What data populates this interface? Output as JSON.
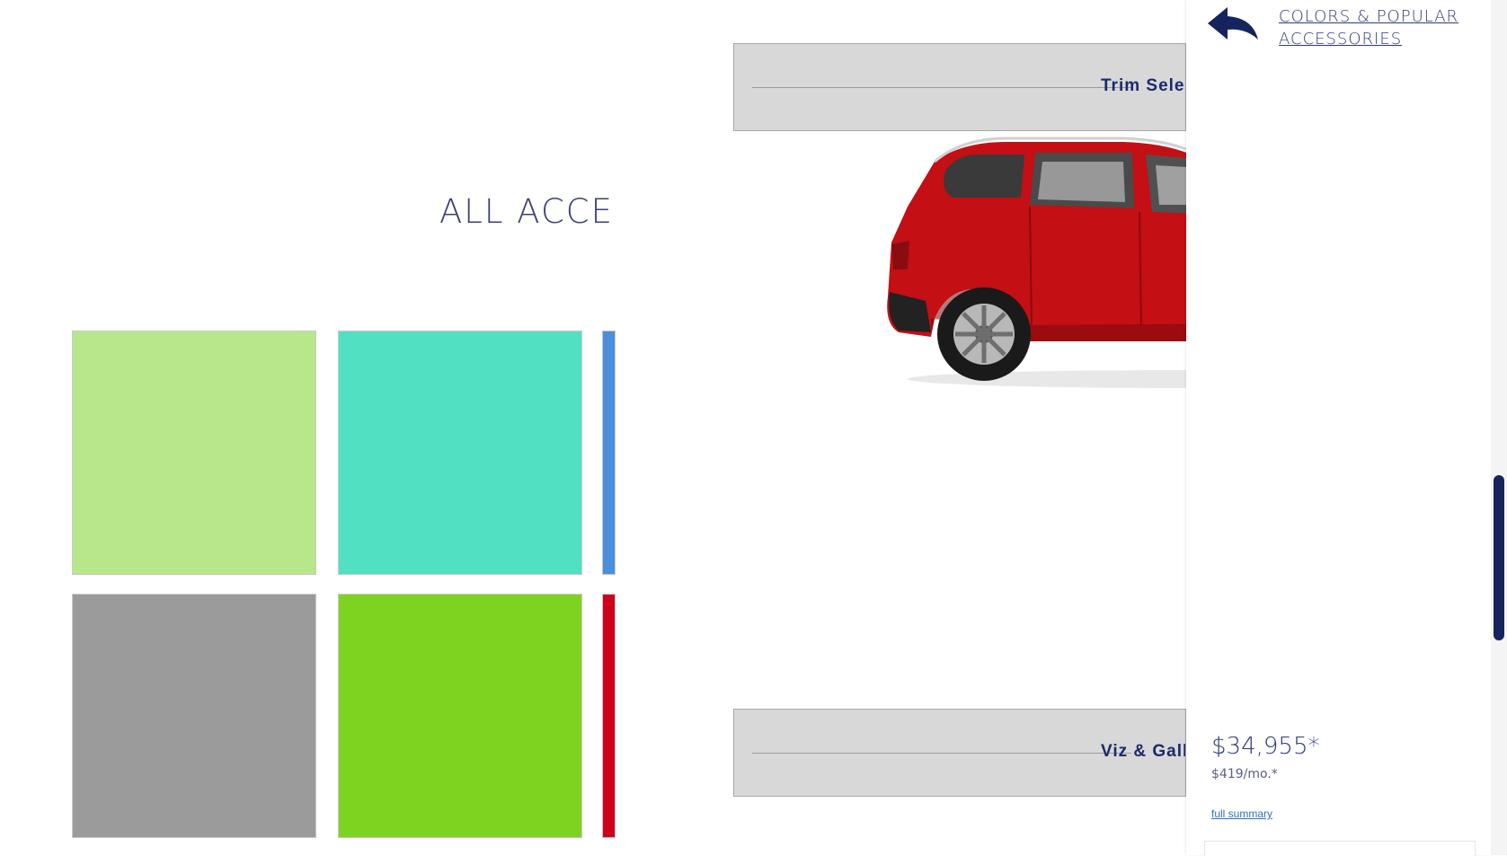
{
  "accessories": {
    "title": "ALL ACCES",
    "swatch_colors": [
      "#b7e78a",
      "#52e0c2",
      "#4a8fdc",
      "#9b9b9b",
      "#7ed321",
      "#d0021b"
    ]
  },
  "banners": {
    "top_label": "Trim Selec",
    "bottom_label": "Viz & Gall"
  },
  "vehicle": {
    "body_color": "#c40f14",
    "image": "red-suv"
  },
  "panel": {
    "back_icon": "back-arrow-icon",
    "title": "COLORS & POPULAR ACCESSORIES",
    "price": "$34,955*",
    "monthly": "$419/mo.*",
    "summary_link": "full summary"
  },
  "colors": {
    "brand_navy": "#16245e",
    "banner_bg": "#d8d8d8"
  }
}
